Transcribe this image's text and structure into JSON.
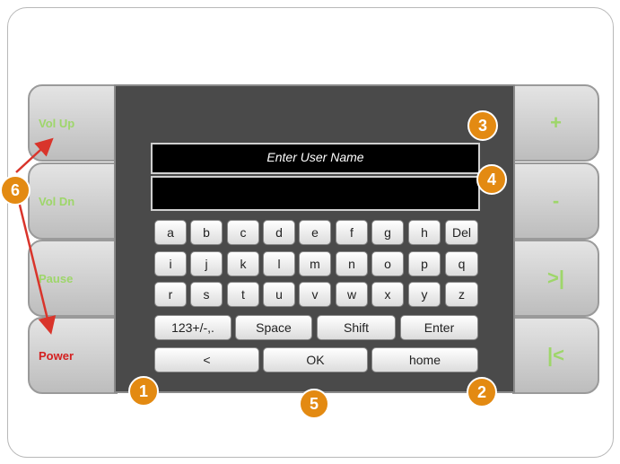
{
  "left_buttons": [
    {
      "label": "Vol Up"
    },
    {
      "label": "Vol Dn"
    },
    {
      "label": "Pause"
    },
    {
      "label": "Power"
    }
  ],
  "right_buttons": [
    {
      "label": "+"
    },
    {
      "label": "-"
    },
    {
      "label": ">|"
    },
    {
      "label": "|<"
    }
  ],
  "fields": {
    "username_prompt": "Enter User Name",
    "username_value": ""
  },
  "keys": {
    "row1": [
      "a",
      "b",
      "c",
      "d",
      "e",
      "f",
      "g",
      "h",
      "Del"
    ],
    "row2": [
      "i",
      "j",
      "k",
      "l",
      "m",
      "n",
      "o",
      "p",
      "q"
    ],
    "row3": [
      "r",
      "s",
      "t",
      "u",
      "v",
      "w",
      "x",
      "y",
      "z"
    ],
    "row4": [
      "123+/-,.",
      "Space",
      "Shift",
      "Enter"
    ],
    "row5": [
      "<",
      "OK",
      "home"
    ]
  },
  "badges": [
    "1",
    "2",
    "3",
    "4",
    "5",
    "6"
  ],
  "colors": {
    "badge": "#e38a12",
    "side_label": "#9ed66a",
    "power_label": "#d42020",
    "arrow": "#d9342b"
  }
}
